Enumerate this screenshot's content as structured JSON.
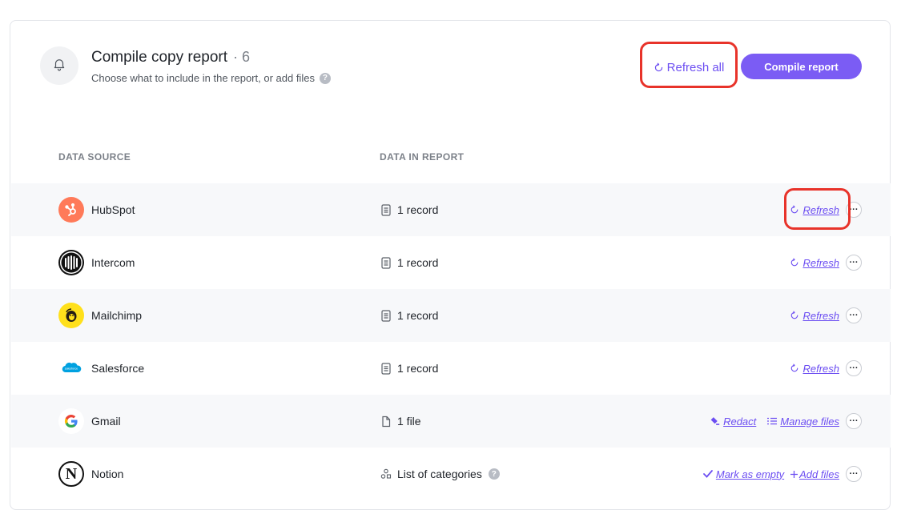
{
  "header": {
    "title": "Compile copy report",
    "separator": "·",
    "count": "6",
    "subtitle": "Choose what to include in the report, or add files",
    "help": "?",
    "refresh_all_label": "Refresh all",
    "compile_label": "Compile report"
  },
  "columns": {
    "source": "DATA SOURCE",
    "data": "DATA IN REPORT"
  },
  "rows": [
    {
      "name": "HubSpot",
      "data": "1 record",
      "action1": "Refresh"
    },
    {
      "name": "Intercom",
      "data": "1 record",
      "action1": "Refresh"
    },
    {
      "name": "Mailchimp",
      "data": "1 record",
      "action1": "Refresh"
    },
    {
      "name": "Salesforce",
      "data": "1 record",
      "action1": "Refresh"
    },
    {
      "name": "Gmail",
      "data": "1 file",
      "action1": "Redact",
      "action2": "Manage files"
    },
    {
      "name": "Notion",
      "data": "List of categories",
      "help": "?",
      "action1": "Mark as empty",
      "action2": "Add files"
    }
  ],
  "more_label": "···",
  "icons": {
    "header": "bell-icon",
    "refresh": "refresh-icon",
    "record": "document-icon",
    "file": "file-icon",
    "categories": "categories-icon",
    "redact": "redact-icon",
    "manage": "list-icon",
    "mark": "check-icon",
    "add": "plus-icon",
    "more": "more-icon"
  },
  "colors": {
    "accent": "#6c4ef2",
    "button": "#7b5cf4",
    "callout": "#e8332a",
    "row_alt": "#f7f8fa",
    "hubspot": "#ff7a59",
    "mailchimp": "#ffe01b",
    "salesforce": "#00a1e0"
  }
}
